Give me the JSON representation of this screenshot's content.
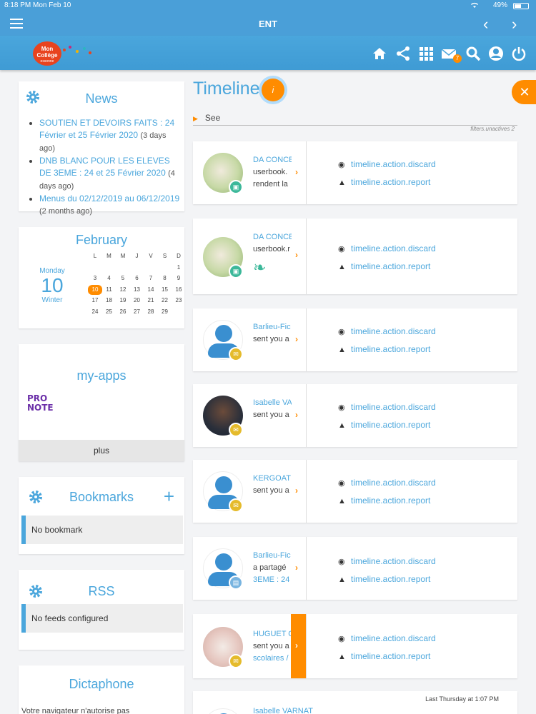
{
  "status": {
    "time": "8:18 PM",
    "date": "Mon Feb 10",
    "battery": "49%"
  },
  "nav": {
    "title": "ENT"
  },
  "header": {
    "logo_line1": "Mon",
    "logo_line2": "Collège",
    "logo_sub": "essonne",
    "messages_badge": "7"
  },
  "news": {
    "title": "News",
    "items": [
      {
        "title": "SOUTIEN ET DEVOIRS FAITS : 24 Février et 25 Février 2020",
        "age": "(3 days ago)"
      },
      {
        "title": "DNB BLANC POUR LES ELEVES DE 3EME : 24 et 25 Février 2020",
        "age": "(4 days ago)"
      },
      {
        "title": "Menus du 02/12/2019 au 06/12/2019",
        "age": "(2 months ago)"
      }
    ]
  },
  "calendar": {
    "month": "February",
    "day_name": "Monday",
    "day_num": "10",
    "season": "Winter",
    "weekdays": [
      "L",
      "M",
      "M",
      "J",
      "V",
      "S",
      "D"
    ],
    "weeks": [
      [
        "",
        "",
        "",
        "",
        "",
        "",
        "1"
      ],
      [
        "3",
        "4",
        "5",
        "6",
        "7",
        "8",
        "9"
      ],
      [
        "10",
        "11",
        "12",
        "13",
        "14",
        "15",
        "16"
      ],
      [
        "17",
        "18",
        "19",
        "20",
        "21",
        "22",
        "23"
      ],
      [
        "24",
        "25",
        "26",
        "27",
        "28",
        "29",
        ""
      ]
    ],
    "today": "10"
  },
  "myapps": {
    "title": "my-apps",
    "app_line1": "PRO",
    "app_line2": "NOTE",
    "more": "plus"
  },
  "bookmarks": {
    "title": "Bookmarks",
    "empty": "No bookmark"
  },
  "rss": {
    "title": "RSS",
    "empty": "No feeds configured"
  },
  "dictaphone": {
    "title": "Dictaphone",
    "text": "Votre navigateur n'autorise pas"
  },
  "timeline": {
    "title": "Timeline",
    "info": "i",
    "see": "See",
    "filters": "filters.unactives 2",
    "discard": "timeline.action.discard",
    "report": "timeline.action.report",
    "items": [
      {
        "name": "DA CONCE",
        "line2": "userbook.",
        "line3": "rendent la"
      },
      {
        "name": "DA CONCE",
        "line2": "userbook.r",
        "line3": ""
      },
      {
        "name": "Barlieu-Fic",
        "line2": "sent you a",
        "line3": ""
      },
      {
        "name": "Isabelle VA",
        "line2": "sent you a",
        "line3": ""
      },
      {
        "name": "KERGOAT",
        "line2": "sent you a",
        "line3": ""
      },
      {
        "name": "Barlieu-Fic",
        "line2": "a partagé",
        "line3": "3EME : 24"
      },
      {
        "name": "HUGUET C",
        "line2": "sent you a",
        "line3": "scolaires /"
      },
      {
        "name": "Isabelle VARNAT",
        "line2": "",
        "line3": "",
        "time": "Last Thursday at 1:07 PM"
      }
    ]
  }
}
